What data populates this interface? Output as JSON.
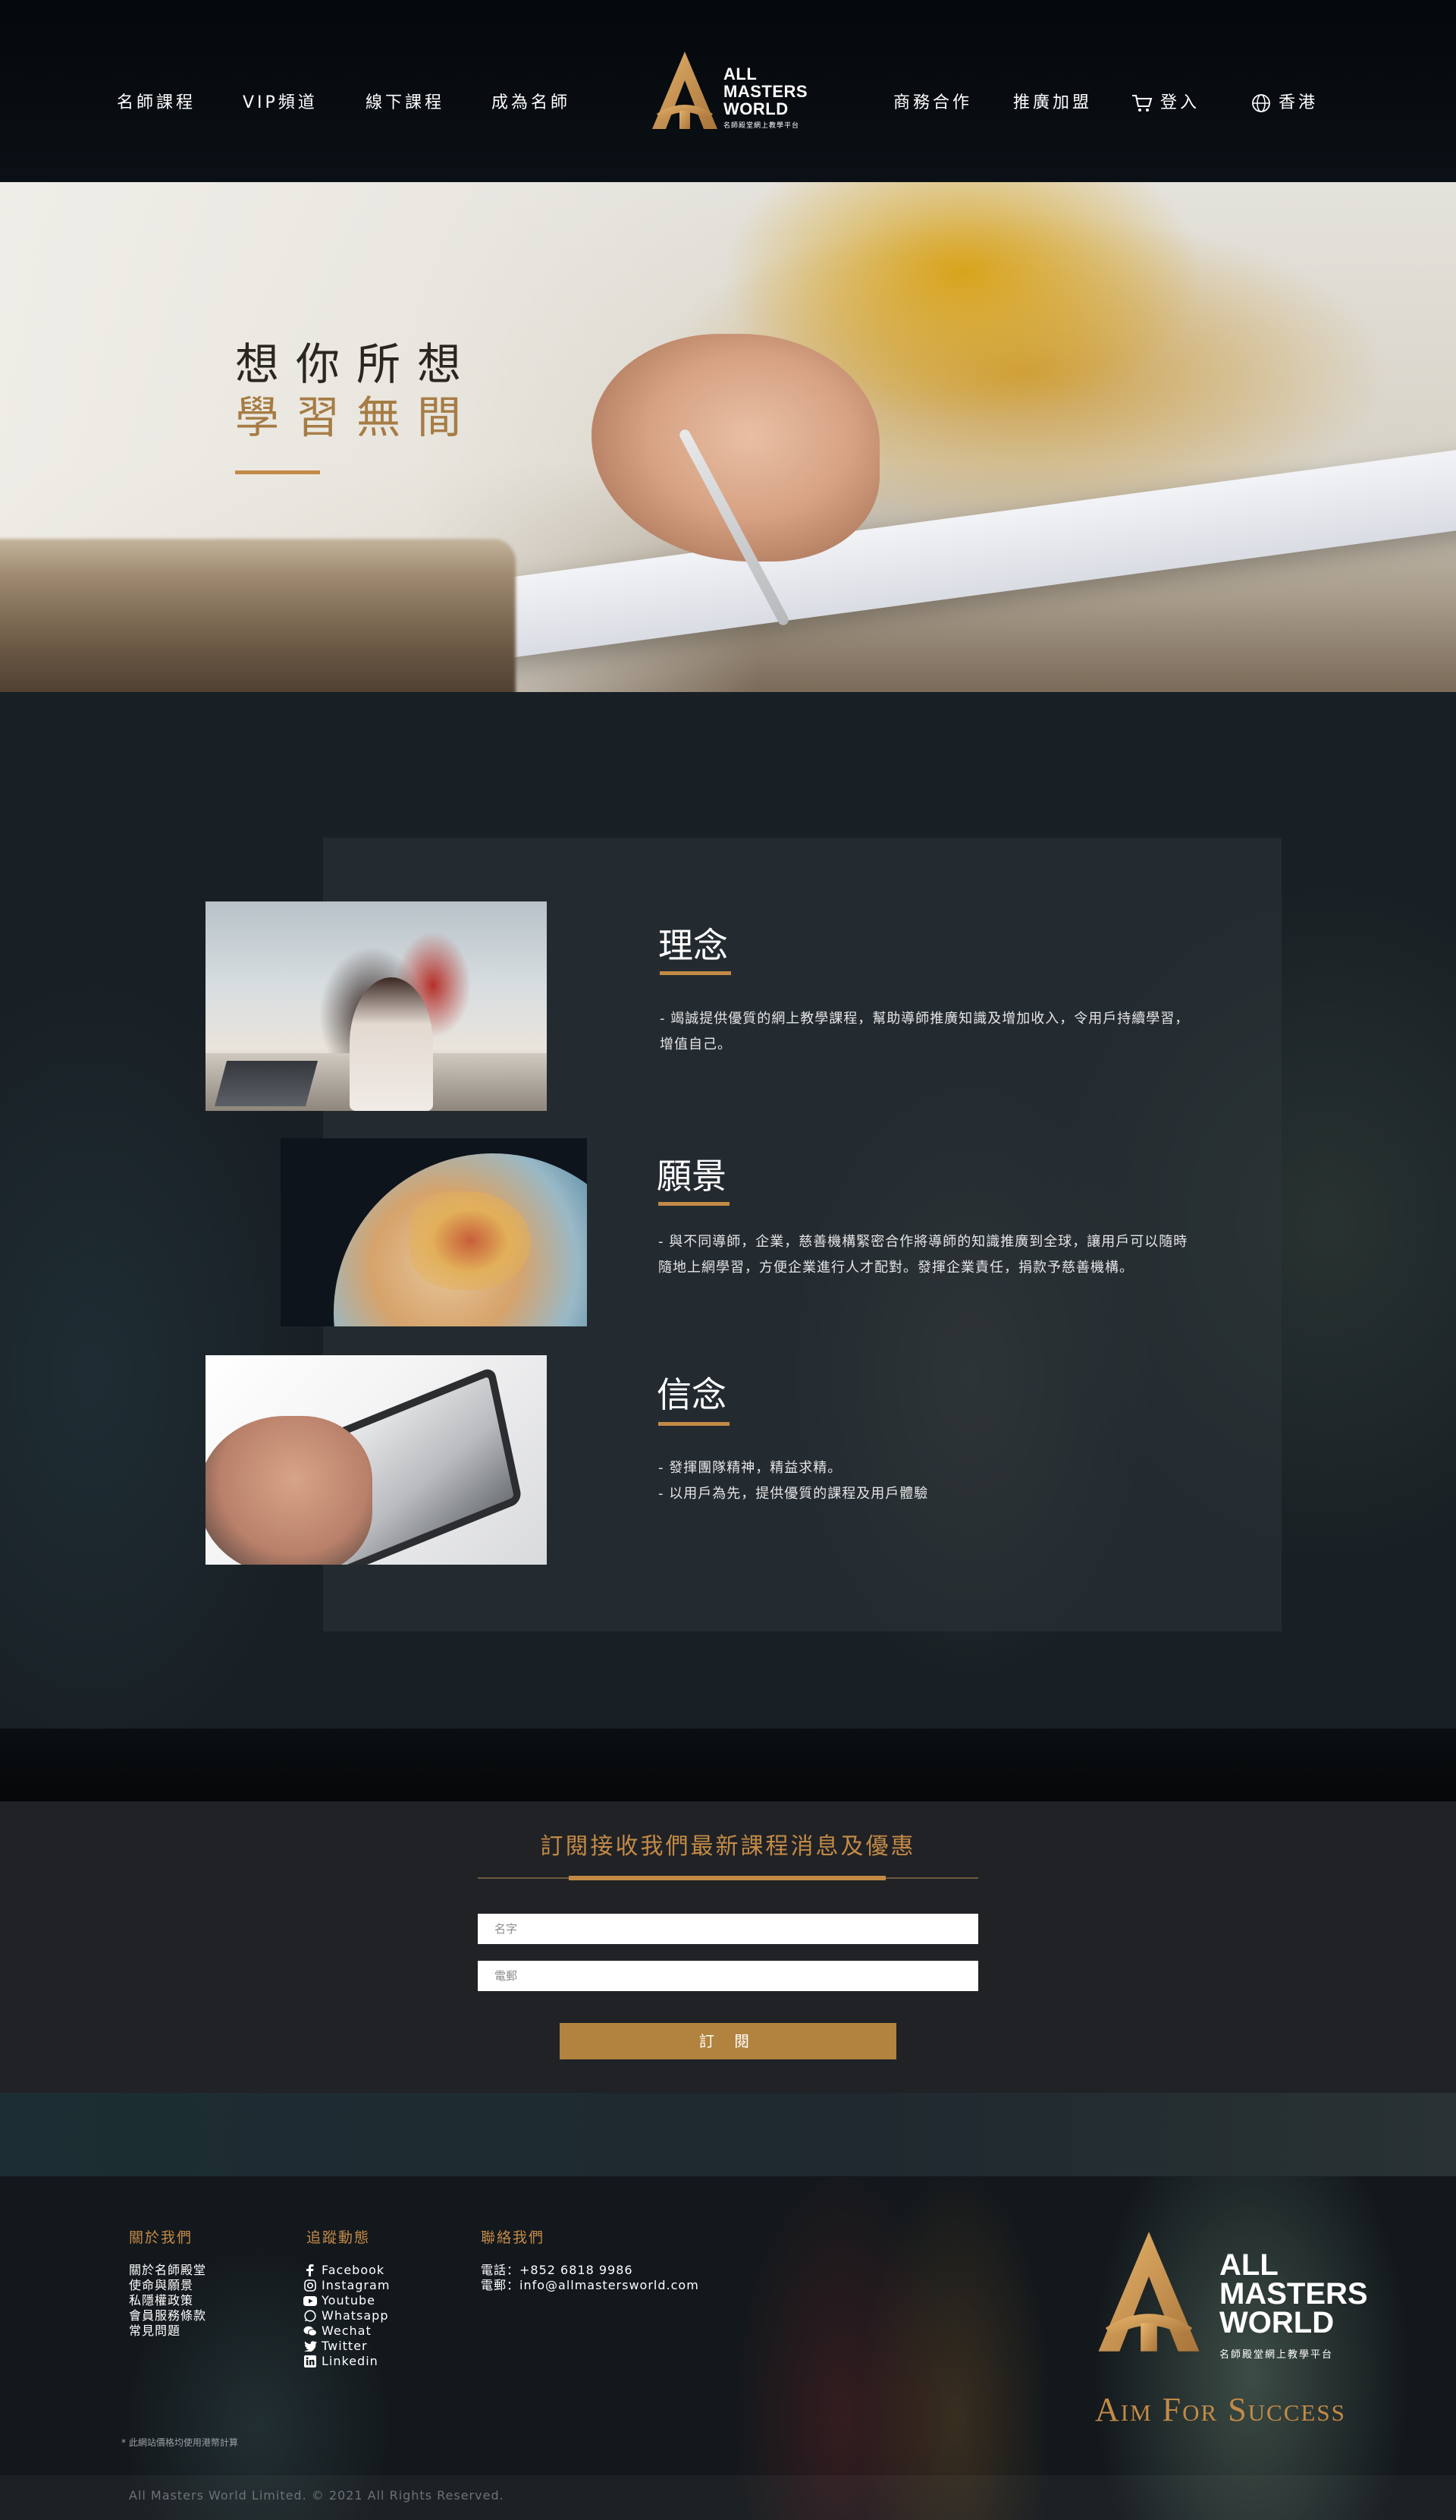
{
  "nav": {
    "left_items": [
      "名師課程",
      "VIP頻道",
      "線下課程",
      "成為名師"
    ],
    "right_items": [
      "商務合作",
      "推廣加盟"
    ],
    "login": "登入",
    "region": "香港",
    "logo": {
      "line1": "ALL",
      "line2": "MASTERS",
      "line3": "WORLD",
      "sub": "名師殿堂網上教學平台"
    }
  },
  "hero": {
    "line1": "想你所想",
    "line2": "學習無間"
  },
  "about": {
    "sections": [
      {
        "title": "理念",
        "text": "- 竭誠提供優質的網上教學課程，幫助導師推廣知識及增加收入，令用戶持續學習，　　增值自己。"
      },
      {
        "title": "願景",
        "text": "- 與不同導師，企業，慈善機構緊密合作將導師的知識推廣到全球，讓用戶可以隨時　隨地上網學習，方便企業進行人才配對。發揮企業責任，捐款予慈善機構。"
      },
      {
        "title": "信念",
        "lines": [
          "- 發揮團隊精神，精益求精。",
          "- 以用戶為先，提供優質的課程及用戶體驗"
        ]
      }
    ]
  },
  "subscribe": {
    "title": "訂閱接收我們最新課程消息及優惠",
    "name_placeholder": "名字",
    "email_placeholder": "電郵",
    "button": "訂 閱"
  },
  "footer": {
    "about_heading": "關於我們",
    "about_links": [
      "關於名師殿堂",
      "使命與願景",
      "私隱權政策",
      "會員服務條款",
      "常見問題"
    ],
    "follow_heading": "追蹤動態",
    "social": [
      {
        "icon": "facebook-icon",
        "label": "Facebook"
      },
      {
        "icon": "instagram-icon",
        "label": "Instagram"
      },
      {
        "icon": "youtube-icon",
        "label": "Youtube"
      },
      {
        "icon": "whatsapp-icon",
        "label": "Whatsapp"
      },
      {
        "icon": "wechat-icon",
        "label": "Wechat"
      },
      {
        "icon": "twitter-icon",
        "label": "Twitter"
      },
      {
        "icon": "linkedin-icon",
        "label": "Linkedin"
      }
    ],
    "contact_heading": "聯絡我們",
    "phone": "電話：+852 6818 9986",
    "email": "電郵：info@allmastersworld.com",
    "logo": {
      "line1": "ALL",
      "line2": "MASTERS",
      "line3": "WORLD",
      "sub": "名師殿堂網上教學平台"
    },
    "slogan": "Aim For Success",
    "note": "* 此網站價格均使用港幣計算",
    "copyright": "All Masters World Limited. © 2021 All Rights Reserved."
  },
  "colors": {
    "accent": "#c38a46",
    "button": "#b2833e",
    "dark": "#192025"
  }
}
